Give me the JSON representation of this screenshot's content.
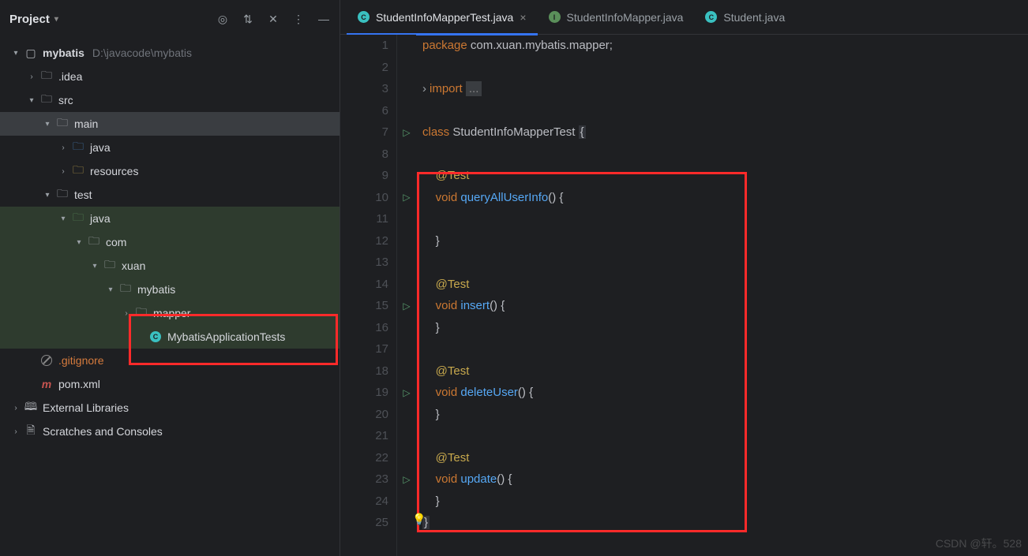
{
  "sidebar": {
    "title": "Project",
    "root": {
      "name": "mybatis",
      "path": "D:\\javacode\\mybatis"
    },
    "nodes": {
      "idea": ".idea",
      "src": "src",
      "main": "main",
      "java_main": "java",
      "resources": "resources",
      "test": "test",
      "java_test": "java",
      "com": "com",
      "xuan": "xuan",
      "mybatis_pkg": "mybatis",
      "mapper": "mapper",
      "mybatis_app_tests": "MybatisApplicationTests",
      "gitignore": ".gitignore",
      "pom": "pom.xml",
      "ext_lib": "External Libraries",
      "scratches": "Scratches and Consoles"
    }
  },
  "tabs": [
    {
      "label": "StudentInfoMapperTest.java",
      "icon": "C",
      "active": true,
      "closable": true
    },
    {
      "label": "StudentInfoMapper.java",
      "icon": "I",
      "active": false,
      "closable": false
    },
    {
      "label": "Student.java",
      "icon": "C",
      "active": false,
      "closable": false
    }
  ],
  "code": {
    "lines": [
      {
        "n": 1,
        "html": "<span class='kw'>package</span> <span class='txt'>com.xuan.mybatis.mapper;</span>"
      },
      {
        "n": 2,
        "html": ""
      },
      {
        "n": 3,
        "fold": true,
        "html": "<span class='kw'>import</span> <span class='ellipsis'>...</span>"
      },
      {
        "n": 6,
        "html": ""
      },
      {
        "n": 7,
        "run": true,
        "html": "<span class='kw'>class</span> <span class='cls'>StudentInfoMapperTest</span> <span class='cur-box'>{</span>"
      },
      {
        "n": 8,
        "html": ""
      },
      {
        "n": 9,
        "html": "    <span class='ann'>@Test</span>"
      },
      {
        "n": 10,
        "run": true,
        "html": "    <span class='kw'>void</span> <span class='fn'>queryAllUserInfo</span>() {"
      },
      {
        "n": 11,
        "html": ""
      },
      {
        "n": 12,
        "html": "    }"
      },
      {
        "n": 13,
        "html": ""
      },
      {
        "n": 14,
        "html": "    <span class='ann'>@Test</span>"
      },
      {
        "n": 15,
        "run": true,
        "html": "    <span class='kw'>void</span> <span class='fn'>insert</span>() {"
      },
      {
        "n": 16,
        "html": "    }"
      },
      {
        "n": 17,
        "html": ""
      },
      {
        "n": 18,
        "html": "    <span class='ann'>@Test</span>"
      },
      {
        "n": 19,
        "run": true,
        "html": "    <span class='kw'>void</span> <span class='fn'>deleteUser</span>() {"
      },
      {
        "n": 20,
        "html": "    }"
      },
      {
        "n": 21,
        "html": ""
      },
      {
        "n": 22,
        "html": "    <span class='ann'>@Test</span>"
      },
      {
        "n": 23,
        "run": true,
        "html": "    <span class='kw'>void</span> <span class='fn'>update</span>() {"
      },
      {
        "n": 24,
        "html": "    }"
      },
      {
        "n": 25,
        "html": "<span class='cur-box'>}</span>"
      }
    ]
  },
  "watermark": "CSDN @轩。528"
}
